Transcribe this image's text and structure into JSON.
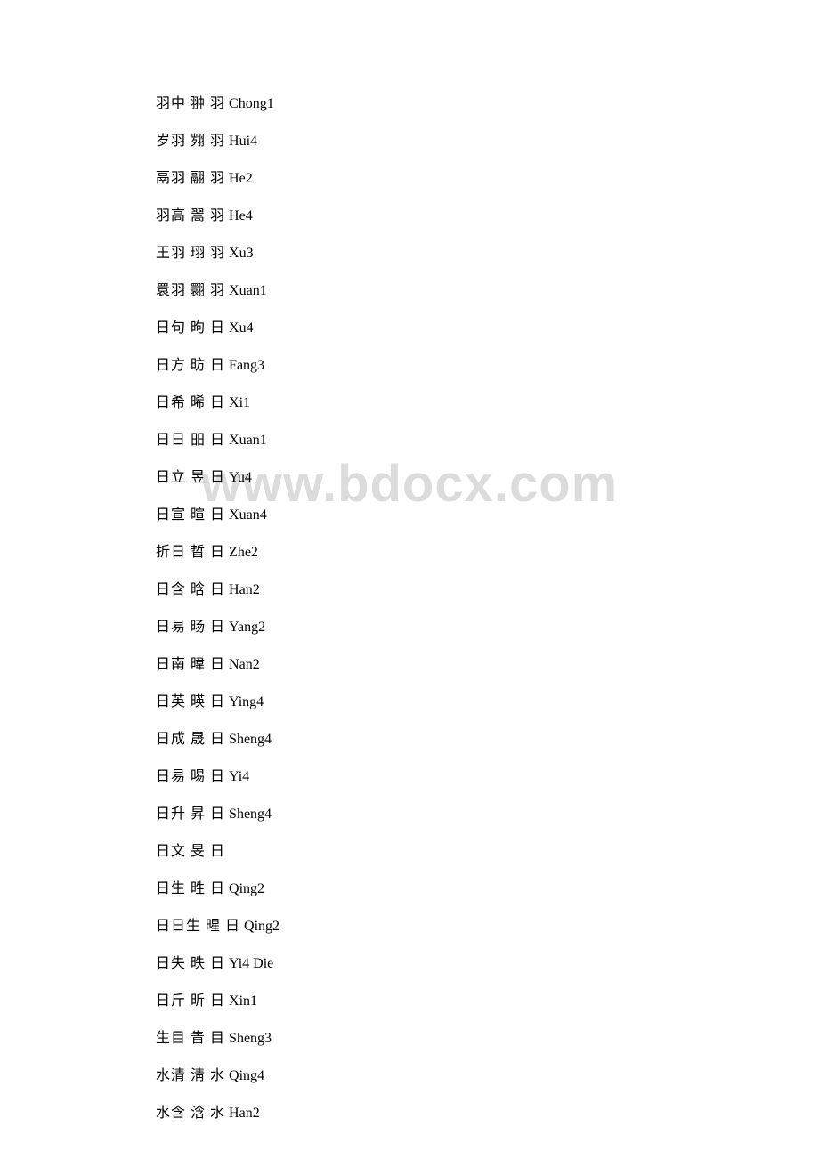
{
  "watermark": "www.bdocx.com",
  "lines": [
    {
      "components": "羽中",
      "character": "翀",
      "radical": "羽",
      "pinyin": "Chong1"
    },
    {
      "components": "岁羽",
      "character": "翙",
      "radical": "羽",
      "pinyin": "Hui4"
    },
    {
      "components": "鬲羽",
      "character": "翮",
      "radical": "羽",
      "pinyin": "He2"
    },
    {
      "components": "羽高",
      "character": "翯",
      "radical": "羽",
      "pinyin": "He4"
    },
    {
      "components": "王羽",
      "character": "珝",
      "radical": "羽",
      "pinyin": "Xu3"
    },
    {
      "components": "睘羽",
      "character": "翾",
      "radical": "羽",
      "pinyin": "Xuan1"
    },
    {
      "components": "日句",
      "character": "昫",
      "radical": "日",
      "pinyin": "Xu4"
    },
    {
      "components": "日方",
      "character": "昉",
      "radical": "日",
      "pinyin": "Fang3"
    },
    {
      "components": "日希",
      "character": "晞",
      "radical": "日",
      "pinyin": "Xi1"
    },
    {
      "components": "日日",
      "character": "昍",
      "radical": "日",
      "pinyin": "Xuan1"
    },
    {
      "components": "日立",
      "character": "昱",
      "radical": "日",
      "pinyin": "Yu4"
    },
    {
      "components": "日宣",
      "character": "暄",
      "radical": "日",
      "pinyin": "Xuan4"
    },
    {
      "components": "折日",
      "character": "晢",
      "radical": "日",
      "pinyin": "Zhe2"
    },
    {
      "components": "日含",
      "character": "晗",
      "radical": "日",
      "pinyin": "Han2"
    },
    {
      "components": "日易",
      "character": "旸",
      "radical": "日",
      "pinyin": "Yang2"
    },
    {
      "components": "日南",
      "character": "暐",
      "radical": "日",
      "pinyin": "Nan2"
    },
    {
      "components": "日英",
      "character": "暎",
      "radical": "日",
      "pinyin": "Ying4"
    },
    {
      "components": "日成",
      "character": "晟",
      "radical": "日",
      "pinyin": "Sheng4"
    },
    {
      "components": "日易",
      "character": "晹",
      "radical": "日",
      "pinyin": "Yi4"
    },
    {
      "components": "日升",
      "character": "昇",
      "radical": "日",
      "pinyin": "Sheng4"
    },
    {
      "components": "日文",
      "character": "旻",
      "radical": "日",
      "pinyin": ""
    },
    {
      "components": "日生",
      "character": "甠",
      "radical": "日",
      "pinyin": "Qing2"
    },
    {
      "components": "日日生",
      "character": "暒",
      "radical": "日",
      "pinyin": "Qing2"
    },
    {
      "components": "日失",
      "character": "昳",
      "radical": "日",
      "pinyin": "Yi4 Die"
    },
    {
      "components": "日斤",
      "character": "昕",
      "radical": "日",
      "pinyin": "Xin1"
    },
    {
      "components": "生目",
      "character": "眚",
      "radical": "目",
      "pinyin": "Sheng3"
    },
    {
      "components": "水清",
      "character": "淸",
      "radical": "水",
      "pinyin": "Qing4"
    },
    {
      "components": "水含",
      "character": "浛",
      "radical": "水",
      "pinyin": "Han2"
    }
  ]
}
